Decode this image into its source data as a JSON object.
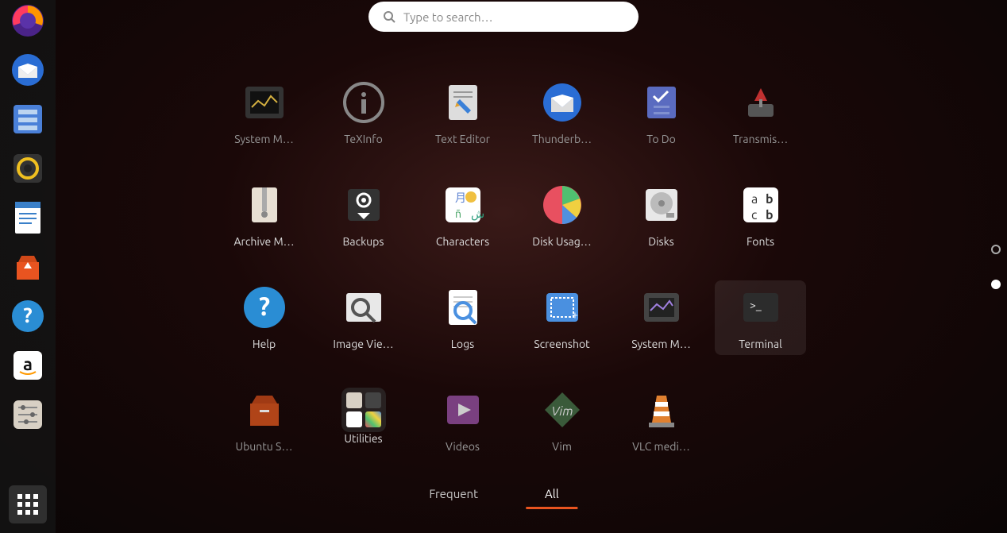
{
  "search": {
    "placeholder": "Type to search…"
  },
  "dock": [
    {
      "name": "firefox",
      "color": "#ff5f3a"
    },
    {
      "name": "thunderbird",
      "color": "#2a6dd4"
    },
    {
      "name": "files",
      "color": "#4a80d8"
    },
    {
      "name": "rhythmbox",
      "color": "#333"
    },
    {
      "name": "libreoffice-writer",
      "color": "#3a80c9"
    },
    {
      "name": "ubuntu-software",
      "color": "#e95420"
    },
    {
      "name": "help",
      "color": "#2a8dd4"
    },
    {
      "name": "amazon",
      "color": "#fff"
    },
    {
      "name": "settings",
      "color": "#ccc"
    }
  ],
  "apps": [
    {
      "label": "System M…",
      "icon": "system-monitor",
      "dimmed": true
    },
    {
      "label": "TeXInfo",
      "icon": "texinfo",
      "dimmed": true
    },
    {
      "label": "Text Editor",
      "icon": "text-editor",
      "dimmed": true
    },
    {
      "label": "Thunderb…",
      "icon": "thunderbird",
      "dimmed": true
    },
    {
      "label": "To Do",
      "icon": "todo",
      "dimmed": true
    },
    {
      "label": "Transmis…",
      "icon": "transmission",
      "dimmed": true
    },
    {
      "label": "Archive M…",
      "icon": "archive-manager",
      "dimmed": false
    },
    {
      "label": "Backups",
      "icon": "backups",
      "dimmed": false
    },
    {
      "label": "Characters",
      "icon": "characters",
      "dimmed": false
    },
    {
      "label": "Disk Usag…",
      "icon": "disk-usage",
      "dimmed": false
    },
    {
      "label": "Disks",
      "icon": "disks",
      "dimmed": false
    },
    {
      "label": "Fonts",
      "icon": "fonts",
      "dimmed": false
    },
    {
      "label": "Help",
      "icon": "help",
      "dimmed": false
    },
    {
      "label": "Image Vie…",
      "icon": "image-viewer",
      "dimmed": false
    },
    {
      "label": "Logs",
      "icon": "logs",
      "dimmed": false
    },
    {
      "label": "Screenshot",
      "icon": "screenshot",
      "dimmed": false
    },
    {
      "label": "System M…",
      "icon": "system-monitor-2",
      "dimmed": false
    },
    {
      "label": "Terminal",
      "icon": "terminal",
      "dimmed": false,
      "highlighted": true
    },
    {
      "label": "Ubuntu S…",
      "icon": "ubuntu-software",
      "dimmed": true
    },
    {
      "label": "Utilities",
      "icon": "utilities-folder",
      "dimmed": false,
      "folder": true
    },
    {
      "label": "Videos",
      "icon": "videos",
      "dimmed": true
    },
    {
      "label": "Vim",
      "icon": "vim",
      "dimmed": true
    },
    {
      "label": "VLC medi…",
      "icon": "vlc",
      "dimmed": true
    }
  ],
  "tabs": {
    "frequent": "Frequent",
    "all": "All"
  },
  "colors": {
    "accent": "#e95420"
  }
}
